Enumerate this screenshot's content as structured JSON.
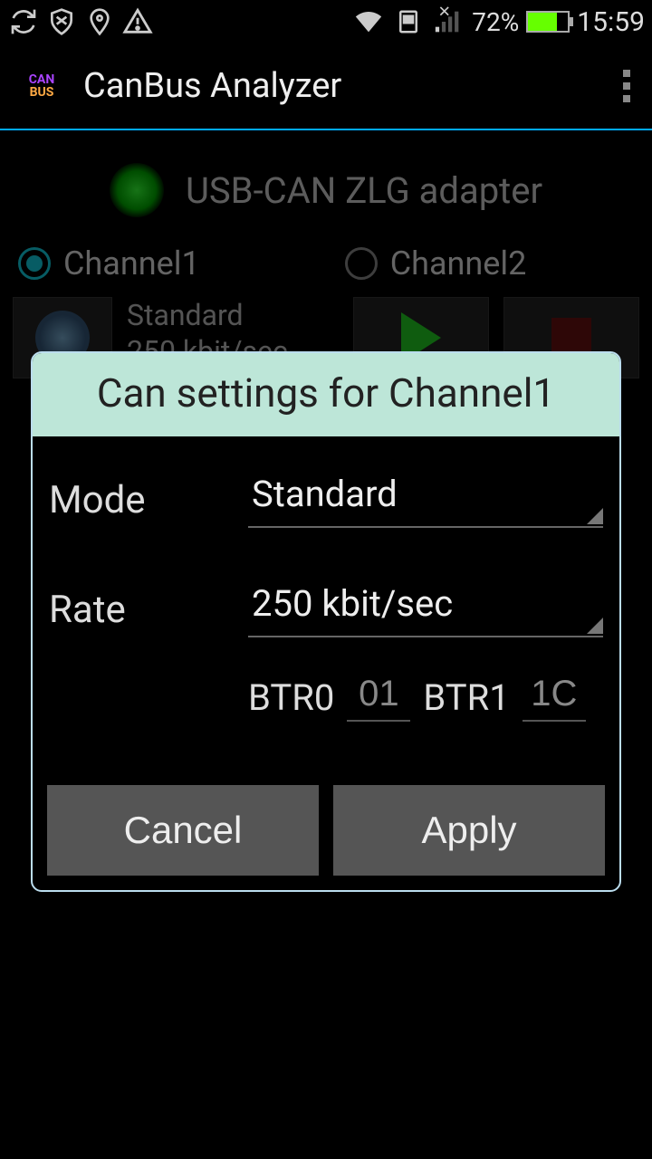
{
  "status": {
    "battery_percent": "72%",
    "time": "15:59"
  },
  "app": {
    "title": "CanBus Analyzer"
  },
  "main": {
    "adapter_label": "USB-CAN ZLG adapter",
    "channel1": "Channel1",
    "channel2": "Channel2",
    "mode_line": "Standard",
    "rate_line": "250 kbit/sec"
  },
  "dialog": {
    "title": "Can settings for Channel1",
    "mode_label": "Mode",
    "mode_value": "Standard",
    "rate_label": "Rate",
    "rate_value": "250 kbit/sec",
    "btr0_label": "BTR0",
    "btr0_value": "01",
    "btr1_label": "BTR1",
    "btr1_value": "1C",
    "cancel": "Cancel",
    "apply": "Apply"
  }
}
